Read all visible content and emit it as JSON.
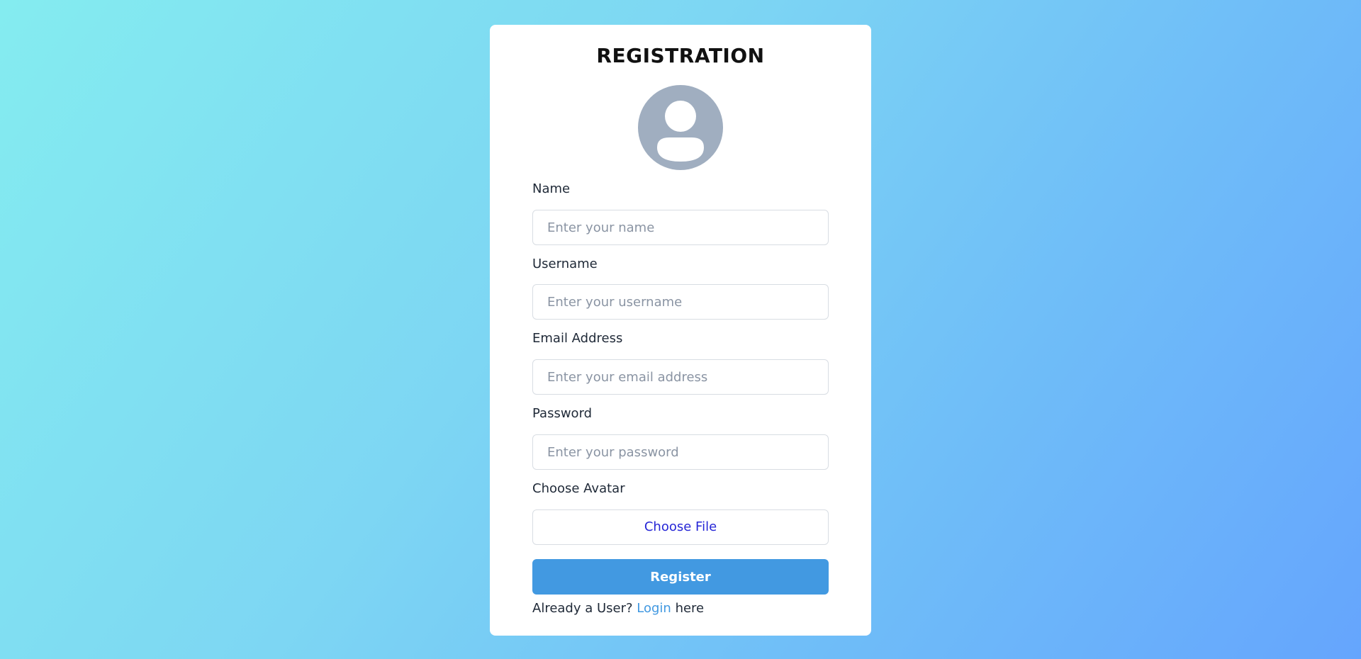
{
  "form": {
    "title": "REGISTRATION",
    "avatar_icon": "user-avatar-icon",
    "fields": [
      {
        "label": "Name",
        "placeholder": "Enter your name",
        "value": ""
      },
      {
        "label": "Username",
        "placeholder": "Enter your username",
        "value": ""
      },
      {
        "label": "Email Address",
        "placeholder": "Enter your email address",
        "value": ""
      },
      {
        "label": "Password",
        "placeholder": "Enter your password",
        "value": ""
      }
    ],
    "avatar_label": "Choose Avatar",
    "file_button_label": "Choose File",
    "register_label": "Register",
    "footer": {
      "prefix": "Already a User? ",
      "link_text": "Login",
      "suffix": " here"
    }
  },
  "colors": {
    "accent": "#4299e1",
    "file_link": "#2626d6",
    "avatar_bg": "#a0aec0"
  }
}
